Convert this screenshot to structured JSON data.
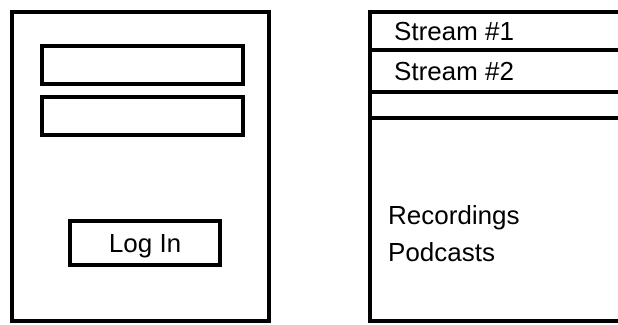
{
  "login": {
    "username_value": "",
    "password_value": "",
    "button_label": "Log In"
  },
  "streams": {
    "items": [
      {
        "label": "Stream #1"
      },
      {
        "label": "Stream #2"
      },
      {
        "label": ""
      }
    ]
  },
  "menu": {
    "items": [
      {
        "label": "Recordings"
      },
      {
        "label": "Podcasts"
      }
    ]
  }
}
